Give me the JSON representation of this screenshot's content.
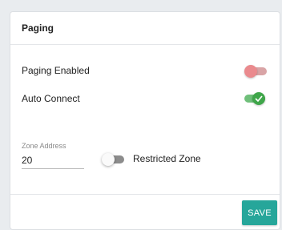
{
  "card": {
    "title": "Paging"
  },
  "settings": {
    "paging_enabled": {
      "label": "Paging Enabled",
      "state": "off"
    },
    "auto_connect": {
      "label": "Auto Connect",
      "state": "on"
    },
    "zone_address": {
      "label": "Zone Address",
      "value": "20"
    },
    "restricted_zone": {
      "label": "Restricted Zone",
      "state": "off"
    }
  },
  "footer": {
    "save_label": "SAVE"
  },
  "colors": {
    "toggle_off_red": "#ea8a8e",
    "toggle_on_green": "#3fa64a",
    "save_button": "#26a69a"
  },
  "icons": {
    "auto_connect_knob": "checkmark-icon"
  }
}
